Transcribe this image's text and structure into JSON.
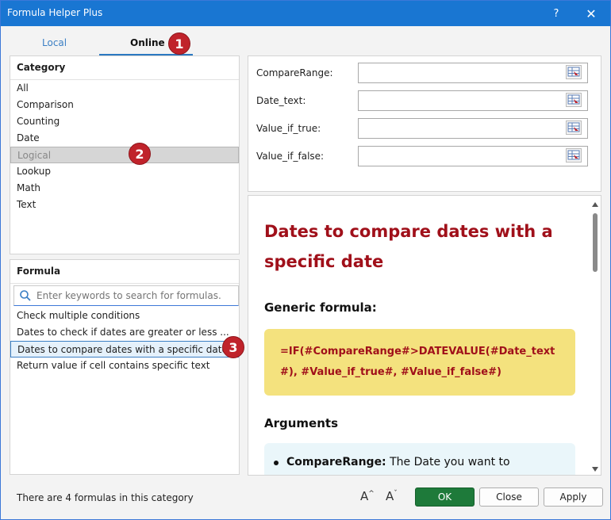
{
  "window": {
    "title": "Formula Helper Plus",
    "help": "?",
    "close": "✕"
  },
  "tabs": [
    {
      "label": "Local"
    },
    {
      "label": "Online"
    }
  ],
  "badges": [
    "1",
    "2",
    "3"
  ],
  "category": {
    "header": "Category",
    "items": [
      "All",
      "Comparison",
      "Counting",
      "Date",
      "Logical",
      "Lookup",
      "Math",
      "Text"
    ],
    "selected_index": 4
  },
  "formula": {
    "header": "Formula",
    "search_placeholder": "Enter keywords to search for formulas.",
    "items": [
      "Check multiple conditions",
      "Dates to check if dates are greater or less ...",
      "Dates to compare dates with a specific date",
      "Return value if cell contains specific text"
    ],
    "selected_index": 2
  },
  "arguments_fields": [
    {
      "label": "CompareRange:",
      "value": ""
    },
    {
      "label": "Date_text:",
      "value": ""
    },
    {
      "label": "Value_if_true:",
      "value": ""
    },
    {
      "label": "Value_if_false:",
      "value": ""
    }
  ],
  "doc": {
    "title": "Dates to compare dates with a specific date",
    "generic_heading": "Generic formula:",
    "formula_text": "=IF(#CompareRange#>DATEVALUE(#Date_text#), #Value_if_true#, #Value_if_false#)",
    "arguments_heading": "Arguments",
    "arg_name": "CompareRange:",
    "arg_desc": " The Date you want to"
  },
  "footer": {
    "status": "There are 4 formulas in this category",
    "increase_font": "A",
    "decrease_font": "A",
    "ok": "OK",
    "close": "Close",
    "apply": "Apply"
  },
  "colors": {
    "accent": "#1976d2",
    "badge": "#c0232b",
    "title_red": "#a0101a",
    "code_bg": "#f4e27e",
    "ok_green": "#1e7a3a"
  }
}
